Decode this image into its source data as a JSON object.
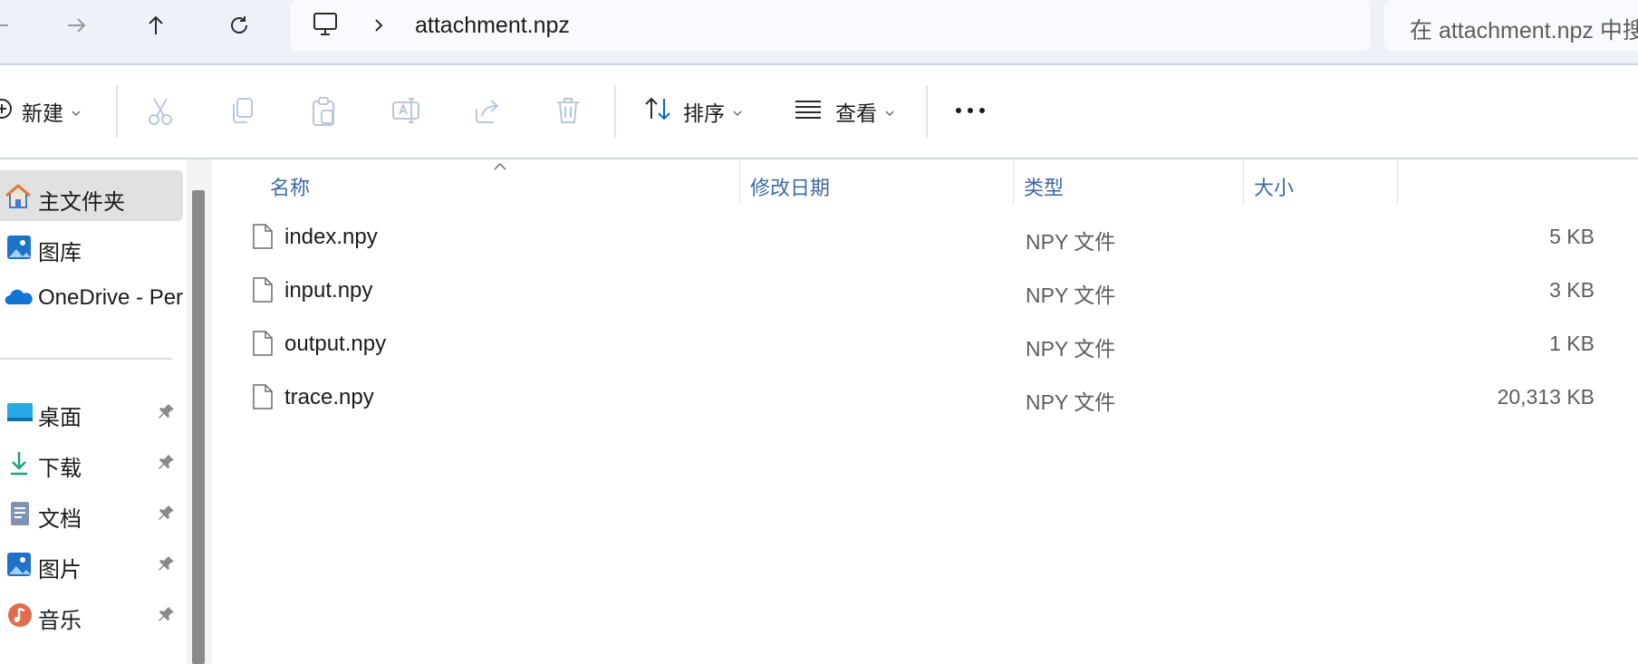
{
  "nav": {
    "back_icon": "arrow-left-icon",
    "forward_icon": "arrow-right-icon",
    "up_icon": "arrow-up-icon",
    "refresh_icon": "refresh-icon"
  },
  "address": {
    "location_icon": "this-pc-icon",
    "path_segment": "attachment.npz"
  },
  "search": {
    "placeholder": "在 attachment.npz 中搜"
  },
  "toolbar": {
    "new_label": "新建",
    "sort_label": "排序",
    "view_label": "查看",
    "more_icon": "more-icon",
    "action_icons": [
      "cut-icon",
      "copy-icon",
      "paste-icon",
      "rename-icon",
      "share-icon",
      "delete-icon"
    ]
  },
  "sidebar": {
    "items": [
      {
        "label": "主文件夹",
        "icon": "home-icon",
        "selected": true
      },
      {
        "label": "图库",
        "icon": "gallery-icon"
      },
      {
        "label": "OneDrive - Per",
        "icon": "onedrive-icon"
      },
      {
        "label": "桌面",
        "icon": "desktop-icon",
        "pinned": true
      },
      {
        "label": "下载",
        "icon": "download-icon",
        "pinned": true
      },
      {
        "label": "文档",
        "icon": "documents-icon",
        "pinned": true
      },
      {
        "label": "图片",
        "icon": "pictures-icon",
        "pinned": true
      },
      {
        "label": "音乐",
        "icon": "music-icon",
        "pinned": true
      }
    ]
  },
  "columns": {
    "name": "名称",
    "modified": "修改日期",
    "type": "类型",
    "size": "大小"
  },
  "files": [
    {
      "name": "index.npy",
      "modified": "",
      "type": "NPY 文件",
      "size": "5 KB"
    },
    {
      "name": "input.npy",
      "modified": "",
      "type": "NPY 文件",
      "size": "3 KB"
    },
    {
      "name": "output.npy",
      "modified": "",
      "type": "NPY 文件",
      "size": "1 KB"
    },
    {
      "name": "trace.npy",
      "modified": "",
      "type": "NPY 文件",
      "size": "20,313 KB"
    }
  ],
  "colors": {
    "accent": "#0067c0",
    "header_text": "#3d6aa5",
    "chrome_bg": "#eef1f8",
    "selected_bg": "#e1e1e1"
  }
}
